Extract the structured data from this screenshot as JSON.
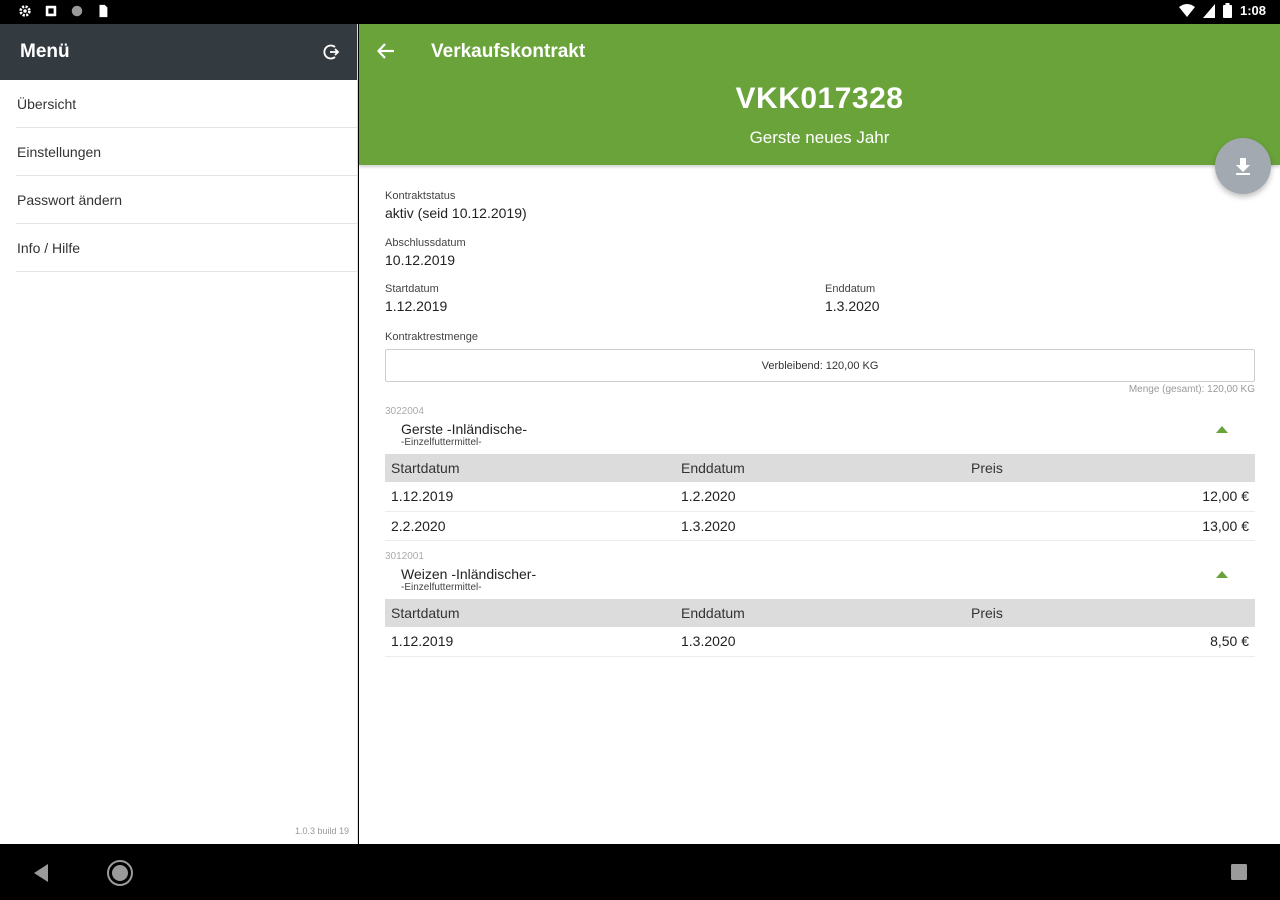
{
  "status_bar": {
    "time": "1:08",
    "icons": [
      "settings-icon",
      "sd-card-icon",
      "circle-icon",
      "sim-icon",
      "wifi-icon",
      "signal-icon",
      "battery-icon"
    ]
  },
  "sidebar": {
    "title": "Menü",
    "logout_icon": "logout-icon",
    "items": [
      {
        "label": "Übersicht"
      },
      {
        "label": "Einstellungen"
      },
      {
        "label": "Passwort ändern"
      },
      {
        "label": "Info / Hilfe"
      }
    ],
    "version": "1.0.3 build 19"
  },
  "header": {
    "title": "Verkaufskontrakt",
    "contract_number": "VKK017328",
    "contract_name": "Gerste neues Jahr",
    "accent_color": "#69a33a",
    "back_icon": "arrow-left-icon",
    "fab_icon": "download-icon"
  },
  "details": {
    "status_label": "Kontraktstatus",
    "status_value": "aktiv (seid 10.12.2019)",
    "closing_label": "Abschlussdatum",
    "closing_value": "10.12.2019",
    "start_label": "Startdatum",
    "start_value": "1.12.2019",
    "end_label": "Enddatum",
    "end_value": "1.3.2020",
    "remaining_label": "Kontraktrestmenge",
    "remaining_value": "Verbleibend: 120,00 KG",
    "total_value": "Menge (gesamt): 120,00 KG"
  },
  "products": [
    {
      "article_no": "3022004",
      "name": "Gerste -Inländische-",
      "category": "-Einzelfuttermittel-",
      "columns": [
        "Startdatum",
        "Enddatum",
        "Preis"
      ],
      "rows": [
        {
          "start": "1.12.2019",
          "end": "1.2.2020",
          "price": "12,00 €"
        },
        {
          "start": "2.2.2020",
          "end": "1.3.2020",
          "price": "13,00 €"
        }
      ]
    },
    {
      "article_no": "3012001",
      "name": "Weizen -Inländischer-",
      "category": "-Einzelfuttermittel-",
      "columns": [
        "Startdatum",
        "Enddatum",
        "Preis"
      ],
      "rows": [
        {
          "start": "1.12.2019",
          "end": "1.3.2020",
          "price": "8,50 €"
        }
      ]
    }
  ],
  "nav_bar": {
    "icons": [
      "nav-back-icon",
      "nav-home-icon",
      "nav-recent-apps-icon"
    ]
  }
}
